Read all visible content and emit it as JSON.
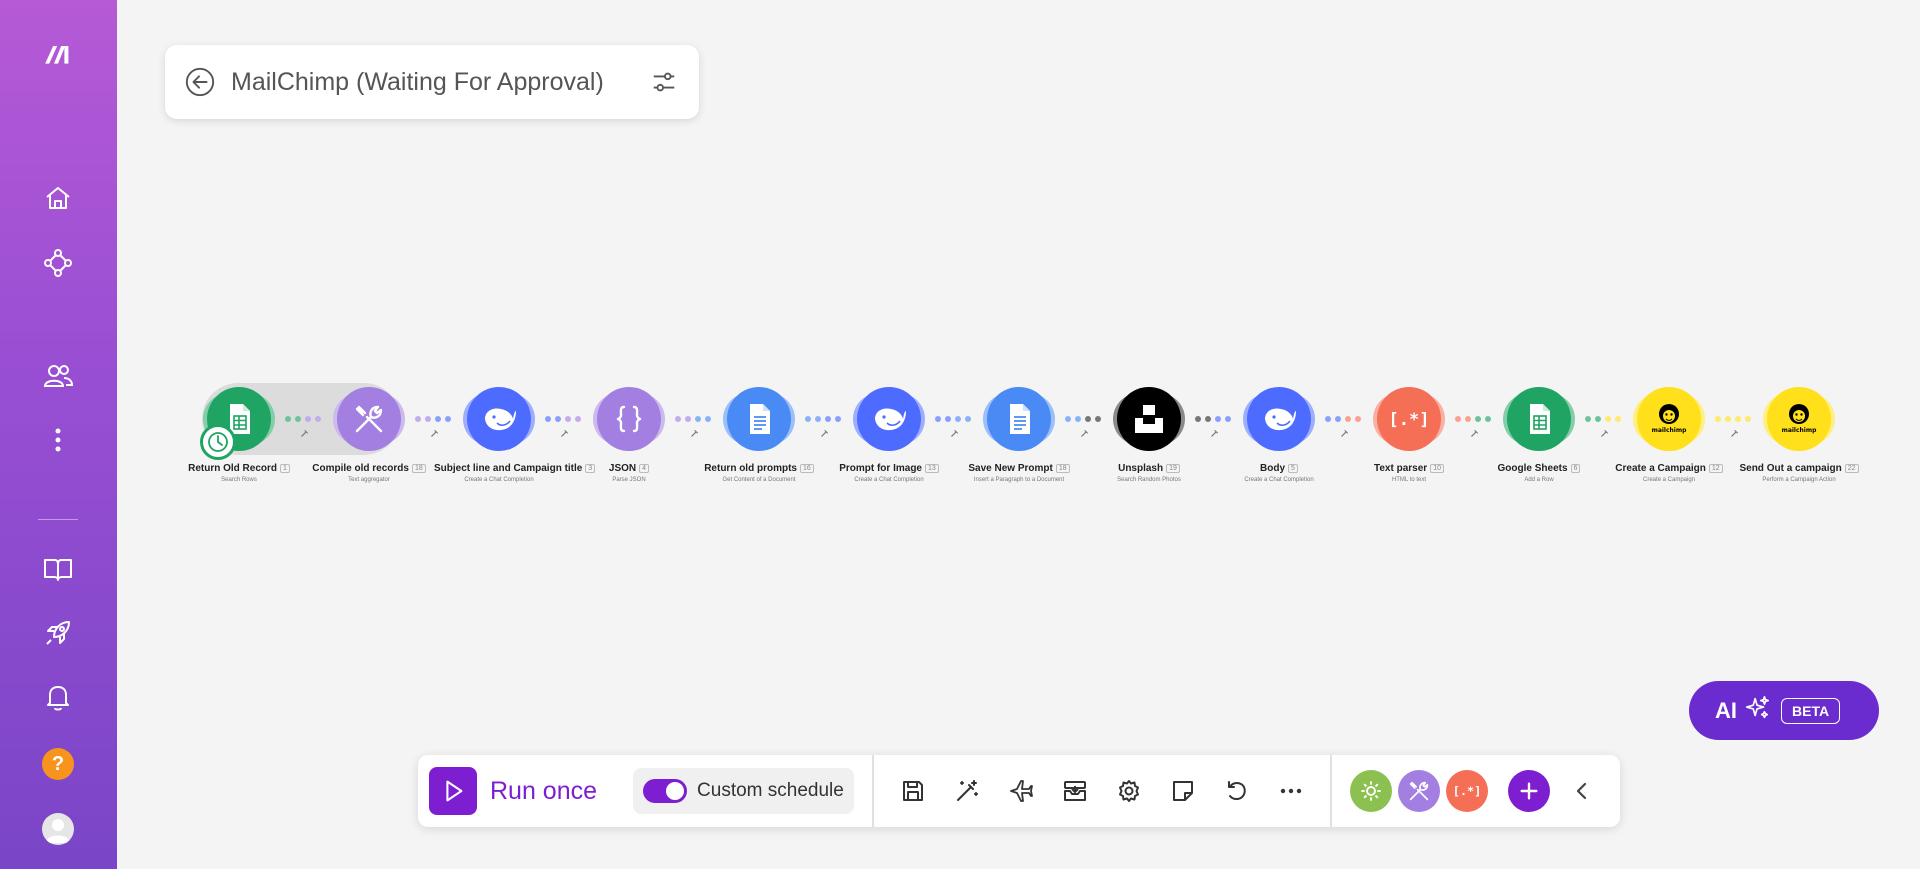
{
  "scenario": {
    "title": "MailChimp (Waiting For Approval)"
  },
  "sidebar": {
    "items": [
      {
        "name": "logo",
        "icon": "make-logo-icon"
      },
      {
        "name": "home",
        "icon": "home-icon"
      },
      {
        "name": "scenarios",
        "icon": "share-nodes-icon"
      },
      {
        "name": "team",
        "icon": "users-icon"
      },
      {
        "name": "more",
        "icon": "more-vertical-icon"
      },
      {
        "name": "docs",
        "icon": "book-icon"
      },
      {
        "name": "whats-new",
        "icon": "rocket-icon"
      },
      {
        "name": "notifications",
        "icon": "bell-icon"
      }
    ],
    "help_label": "?"
  },
  "modules": [
    {
      "name": "Return Old Record",
      "badge": "1",
      "sub": "Search Rows",
      "color": "#1fa463",
      "icon": "google-sheets-icon"
    },
    {
      "name": "Compile old records",
      "badge": "18",
      "sub": "Text aggregator",
      "color": "#a27fe0",
      "icon": "tools-icon"
    },
    {
      "name": "Subject line and Campaign title",
      "badge": "3",
      "sub": "Create a Chat Completion",
      "color": "#4d6bfe",
      "icon": "deepseek-icon"
    },
    {
      "name": "JSON",
      "badge": "4",
      "sub": "Parse JSON",
      "color": "#a27fe0",
      "icon": "json-icon"
    },
    {
      "name": "Return old prompts",
      "badge": "16",
      "sub": "Get Content of a Document",
      "color": "#4a8af4",
      "icon": "google-docs-icon"
    },
    {
      "name": "Prompt for Image",
      "badge": "13",
      "sub": "Create a Chat Completion",
      "color": "#4d6bfe",
      "icon": "deepseek-icon"
    },
    {
      "name": "Save New Prompt",
      "badge": "18",
      "sub": "Insert a Paragraph to a Document",
      "color": "#4a8af4",
      "icon": "google-docs-icon"
    },
    {
      "name": "Unsplash",
      "badge": "19",
      "sub": "Search Random Photos",
      "color": "#000000",
      "icon": "unsplash-icon"
    },
    {
      "name": "Body",
      "badge": "5",
      "sub": "Create a Chat Completion",
      "color": "#4d6bfe",
      "icon": "deepseek-icon"
    },
    {
      "name": "Text parser",
      "badge": "10",
      "sub": "HTML to text",
      "color": "#f56e56",
      "icon": "text-parser-icon"
    },
    {
      "name": "Google Sheets",
      "badge": "6",
      "sub": "Add a Row",
      "color": "#1fa463",
      "icon": "google-sheets-icon"
    },
    {
      "name": "Create a Campaign",
      "badge": "12",
      "sub": "Create a Campaign",
      "color": "#ffe01b",
      "icon": "mailchimp-icon"
    },
    {
      "name": "Send Out a campaign",
      "badge": "22",
      "sub": "Perform a Campaign Action",
      "color": "#ffe01b",
      "icon": "mailchimp-icon"
    }
  ],
  "mailchimp_logo_text": "mailchimp",
  "text_parser_glyph": "[.*]",
  "ai_button": {
    "label": "AI",
    "badge": "BETA"
  },
  "toolbar": {
    "run_label": "Run once",
    "schedule_label": "Custom schedule",
    "tools": [
      "save-icon",
      "auto-align-icon",
      "explain-flow-icon",
      "export-icon",
      "settings-icon",
      "notes-icon",
      "undo-icon",
      "more-horizontal-icon"
    ],
    "mini_modules": [
      {
        "icon": "gear-icon",
        "color": "#8cc152"
      },
      {
        "icon": "tools-icon",
        "color": "#a27fe0"
      },
      {
        "icon": "text-parser-icon",
        "color": "#f56e56"
      }
    ]
  },
  "colors": {
    "accent": "#7d1fd1",
    "ai": "#6a2bcf"
  }
}
